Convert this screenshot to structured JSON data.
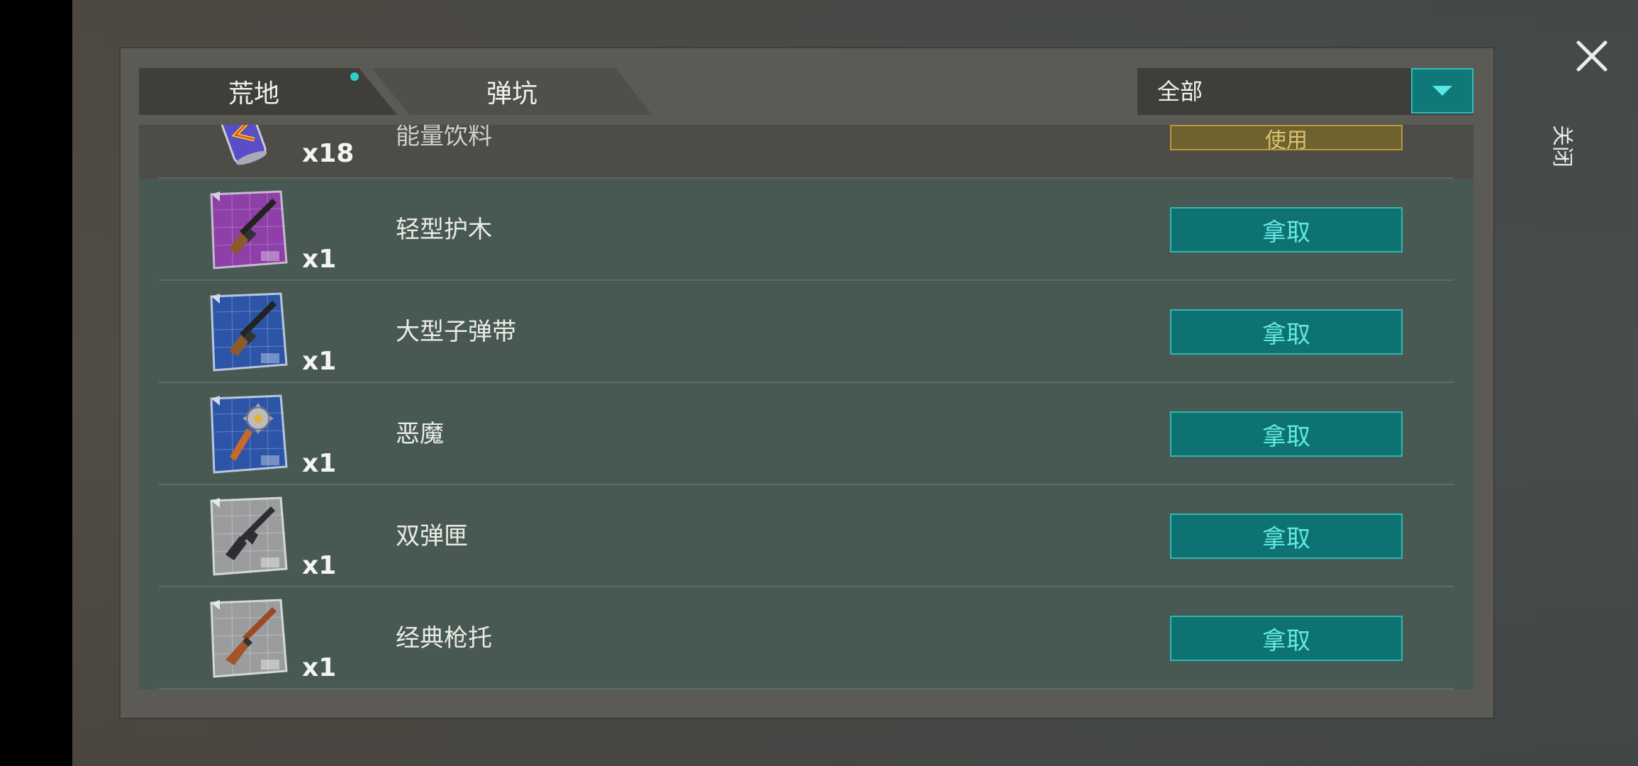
{
  "tabs": [
    {
      "label": "荒地",
      "active": true,
      "has_notification": true
    },
    {
      "label": "弹坑",
      "active": false
    }
  ],
  "filter": {
    "selected": "全部"
  },
  "close": {
    "label": "关闭"
  },
  "partial_item": {
    "name": "能量饮料",
    "qty": "x18",
    "button": "使用",
    "icon": "energy-drink-can"
  },
  "items": [
    {
      "name": "轻型护木",
      "qty": "x1",
      "button": "拿取",
      "icon": "shotgun-blueprint",
      "rarity_color": "#8e3fa8"
    },
    {
      "name": "大型子弹带",
      "qty": "x1",
      "button": "拿取",
      "icon": "shotgun-blueprint",
      "rarity_color": "#2c55a8"
    },
    {
      "name": "恶魔",
      "qty": "x1",
      "button": "拿取",
      "icon": "mace-blueprint",
      "rarity_color": "#2c55a8"
    },
    {
      "name": "双弹匣",
      "qty": "x1",
      "button": "拿取",
      "icon": "rifle-blueprint",
      "rarity_color": "#9a9c9e"
    },
    {
      "name": "经典枪托",
      "qty": "x1",
      "button": "拿取",
      "icon": "rifle-wood-blueprint",
      "rarity_color": "#9a9c9e"
    }
  ]
}
